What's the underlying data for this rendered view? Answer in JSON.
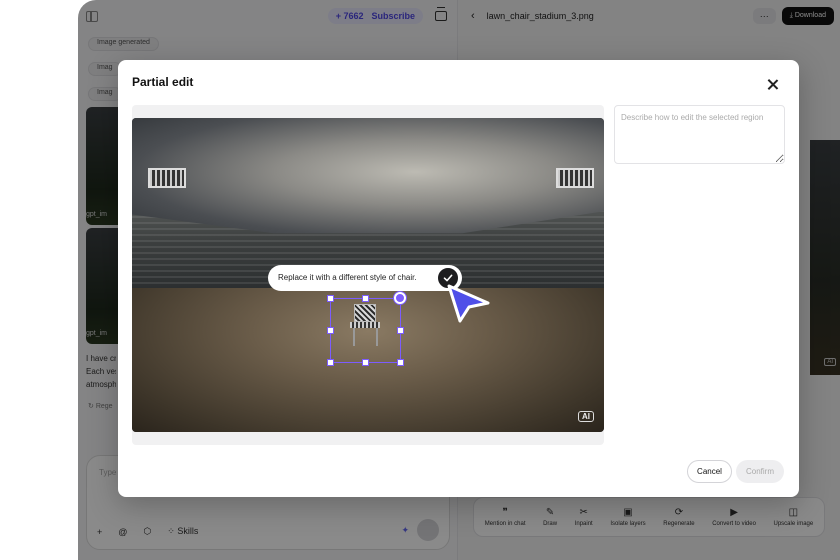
{
  "header": {
    "credits": "+ 7662",
    "subscribe_label": "Subscribe"
  },
  "history": {
    "chip_1": "Image generated",
    "chip_2": "Imag",
    "chip_3": "Imag",
    "thumb_label_1": "gpt_im",
    "thumb_label_2": "gpt_im",
    "message_lines": [
      "I have cr",
      "Each ves",
      "atmosph"
    ],
    "regenerate_label": "Rege"
  },
  "chat": {
    "placeholder": "Type a",
    "skills_label": "Skills"
  },
  "preview": {
    "file_name": "lawn_chair_stadium_3.png",
    "more_label": "···",
    "download_label": "Download",
    "ai_badge": "AI"
  },
  "toolbar": {
    "items": [
      {
        "label": "Mention in chat",
        "icon": "quote-icon"
      },
      {
        "label": "Draw",
        "icon": "pen-icon"
      },
      {
        "label": "Inpaint",
        "icon": "scissors-icon"
      },
      {
        "label": "Isolate layers",
        "icon": "layers-icon"
      },
      {
        "label": "Regenerate",
        "icon": "refresh-icon"
      },
      {
        "label": "Convert to video",
        "icon": "video-icon"
      },
      {
        "label": "Upscale image",
        "icon": "hd-icon"
      }
    ]
  },
  "modal": {
    "title": "Partial edit",
    "ai_badge": "AI",
    "prompt_text": "Replace it with a different style of chair.",
    "description_placeholder": "Describe how to edit the selected region",
    "cancel_label": "Cancel",
    "confirm_label": "Confirm"
  },
  "colors": {
    "accent": "#7c5cff",
    "brand": "#4f46e5"
  }
}
